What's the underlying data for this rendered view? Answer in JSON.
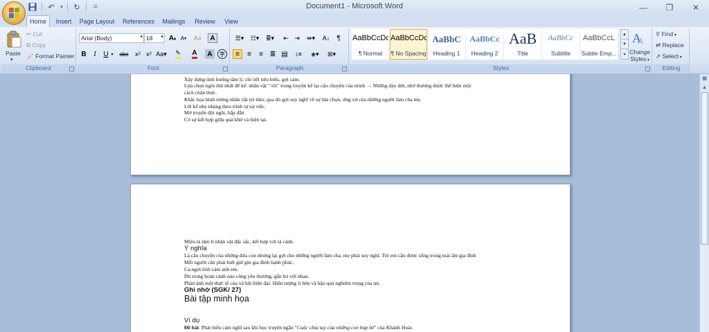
{
  "window": {
    "title": "Document1 - Microsoft Word"
  },
  "quick_access": {
    "customize_label": "="
  },
  "tabs": [
    "Home",
    "Insert",
    "Page Layout",
    "References",
    "Mailings",
    "Review",
    "View"
  ],
  "clipboard": {
    "paste": "Paste",
    "cut": "Cut",
    "copy": "Copy",
    "format_painter": "Format Painter",
    "label": "Clipboard"
  },
  "font": {
    "name": "Arial (Body)",
    "size": "18",
    "label": "Font"
  },
  "paragraph": {
    "label": "Paragraph"
  },
  "styles": {
    "label": "Styles",
    "items": [
      {
        "sample": "AaBbCcDc",
        "name": "¶ Normal"
      },
      {
        "sample": "AaBbCcDc",
        "name": "¶ No Spacing"
      },
      {
        "sample": "AaBbC",
        "name": "Heading 1"
      },
      {
        "sample": "AaBbCc",
        "name": "Heading 2"
      },
      {
        "sample": "AaB",
        "name": "Title"
      },
      {
        "sample": "AaBbCc",
        "name": "Subtitle"
      },
      {
        "sample": "AaBbCcL",
        "name": "Subtle Emp..."
      }
    ],
    "change_styles": "Change Styles"
  },
  "editing": {
    "find": "Find",
    "replace": "Replace",
    "select": "Select",
    "label": "Editing"
  },
  "page1_lines": [
    "Xây dựng tình huống tâm lí, chi tiết tiêu biểu, gợi cảm.",
    "Lựa chọn ngôi thứ nhất để kể: nhân vật \" tôi\" trong truyện kể lại câu chuyện của mình → Những day dứt, nhớ thương được thể hiện một",
    "cách chân thực.",
    "Khắc họa hình tượng nhân vật trẻ nhỏ, qua đó gợi suy nghĩ về sự lựa chọn, ứng xử của những người làm cha mẹ.",
    "Lời kể nhẹ nhàng theo trình tự sự việc.",
    "Mở truyện đột ngột, hấp dẫn",
    "Có sự kết hợp giữa quá khứ và hiện tại."
  ],
  "page2": {
    "line1": "Miêu tả tâm lí nhân vật đặc sắc, kết hợp với tả cảnh.",
    "heading_meaning": "Ý nghĩa",
    "meaning_lines": [
      "Là câu chuyện của những đứa con nhưng lại gợi cho những người làm cha, mẹ phải suy nghĩ. Trẻ em cần được sống trong mái ấm gia đình",
      "Mỗi người cần phải biết giữ gìn gia đình hạnh phúc.",
      "Ca ngợi tình cảm anh em.",
      "Dù trong hoàn cảnh nào cũng yêu thương, gắn bó với nhau.",
      "Phản ánh một thực tế của xã hội hiện đại: Hiện tượng li hôn và hậu quả nghiêm trọng của nó."
    ],
    "heading_notes": "Ghi nhớ (SGK/ 27)",
    "heading_exercise": "Bài tập minh họa",
    "heading_example": "Ví dụ",
    "exercise_label": "Đề bài",
    "exercise_text_a": ": Phát biểu cảm nghĩ sau khi học truyện ngắn \"",
    "exercise_title": "Cuộc chia tay của những con búp bê",
    "exercise_text_b": "\" của Khánh Hoài."
  }
}
